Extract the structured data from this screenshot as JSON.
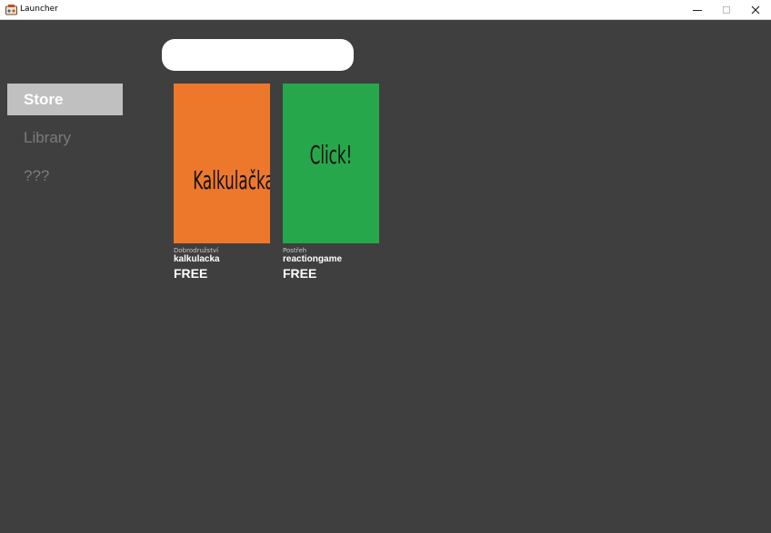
{
  "window": {
    "title": "Launcher"
  },
  "search": {
    "value": "",
    "placeholder": ""
  },
  "sidebar": {
    "items": [
      {
        "label": "Store",
        "active": true
      },
      {
        "label": "Library",
        "active": false
      },
      {
        "label": "???",
        "active": false
      }
    ]
  },
  "store": {
    "games": [
      {
        "cover_text": "Kalkulačka",
        "cover_color": "#ed782c",
        "genre": "Dobrodružství",
        "name": "kalkulacka",
        "price": "FREE"
      },
      {
        "cover_text": "Click!",
        "cover_color": "#27a74c",
        "genre": "Postřeh",
        "name": "reactiongame",
        "price": "FREE"
      }
    ]
  },
  "colors": {
    "background": "#3f3f3f",
    "nav_active": "#c0c0c0",
    "nav_inactive_text": "#7b7b7b"
  }
}
